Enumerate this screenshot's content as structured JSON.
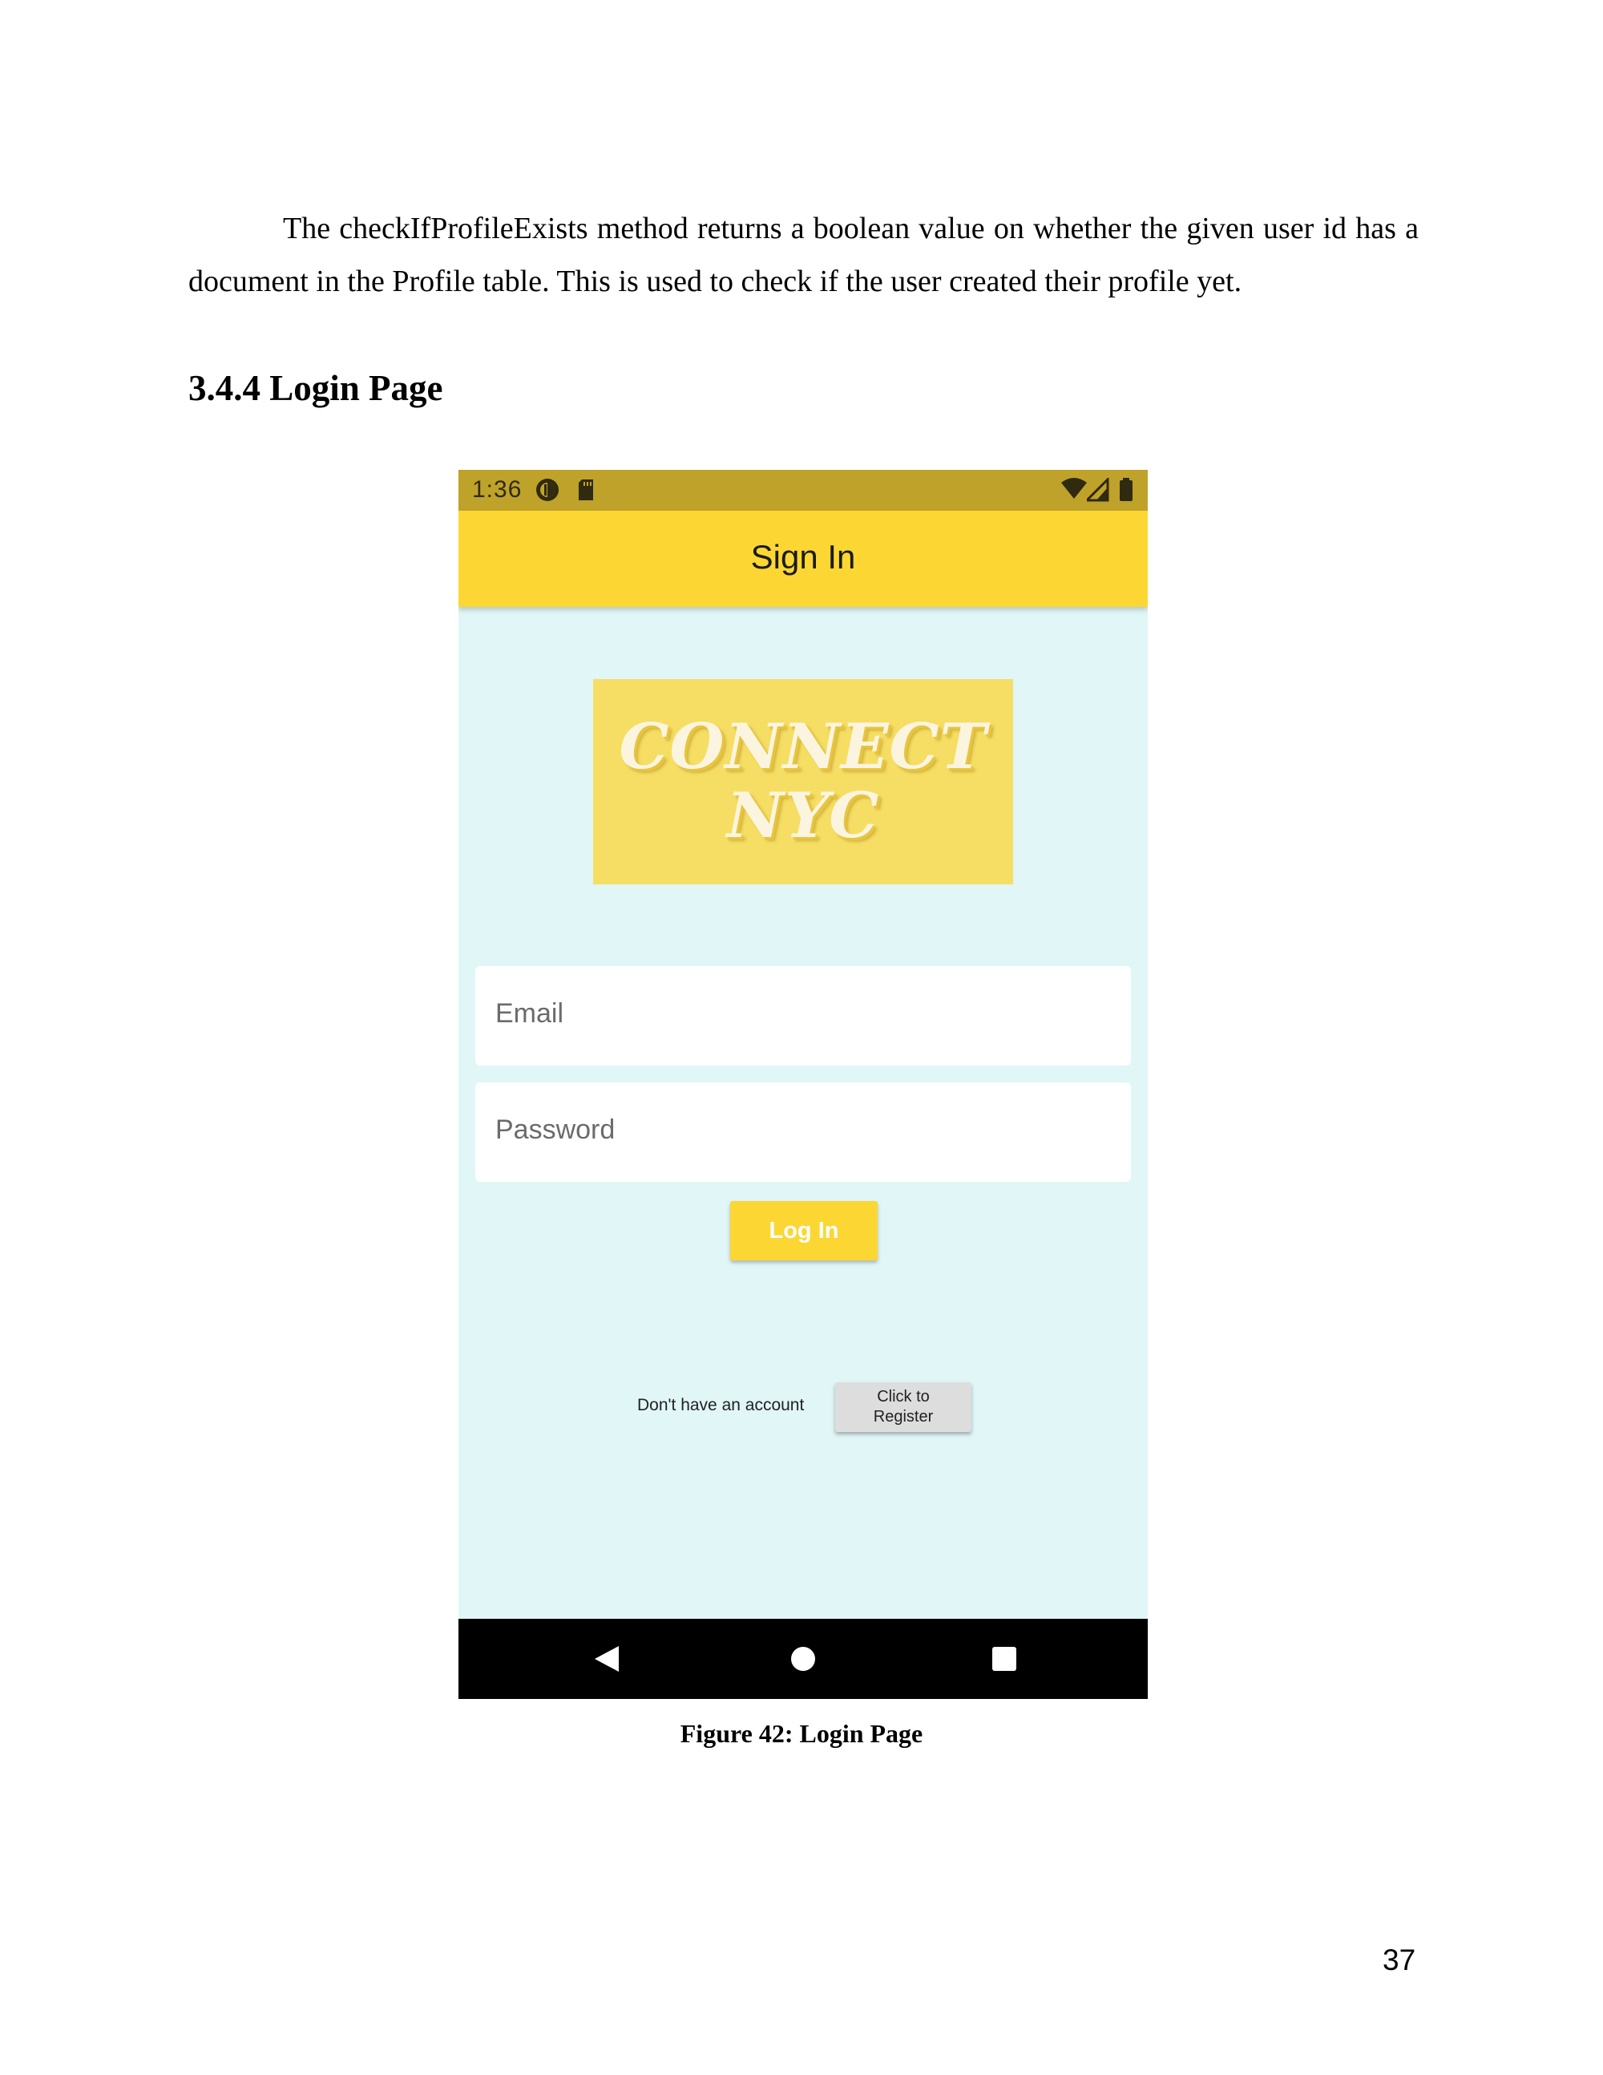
{
  "document": {
    "paragraph": "The checkIfProfileExists method returns a boolean value on whether the given user id has a document in the Profile table. This is used to check if the user created their profile yet.",
    "heading": "3.4.4 Login Page",
    "caption": "Figure 42: Login Page",
    "page_number": "37"
  },
  "phone": {
    "status_bar": {
      "time": "1:36",
      "left_icons": [
        "sync-icon",
        "sd-card-icon"
      ],
      "right_icons": [
        "wifi-icon",
        "cell-signal-icon",
        "battery-icon"
      ],
      "color": "#bfa22a"
    },
    "app_bar": {
      "title": "Sign In",
      "color": "#fcd733"
    },
    "logo": {
      "line1": "CONNECT",
      "line2": "NYC",
      "background": "#f5de63"
    },
    "form": {
      "email_placeholder": "Email",
      "password_placeholder": "Password",
      "login_label": "Log In"
    },
    "register": {
      "prompt": "Don't have an account",
      "button_line1": "Click to",
      "button_line2": "Register"
    },
    "nav_bar": {
      "icons": [
        "back-icon",
        "home-icon",
        "recents-icon"
      ]
    },
    "background": "#e0f6f7"
  }
}
